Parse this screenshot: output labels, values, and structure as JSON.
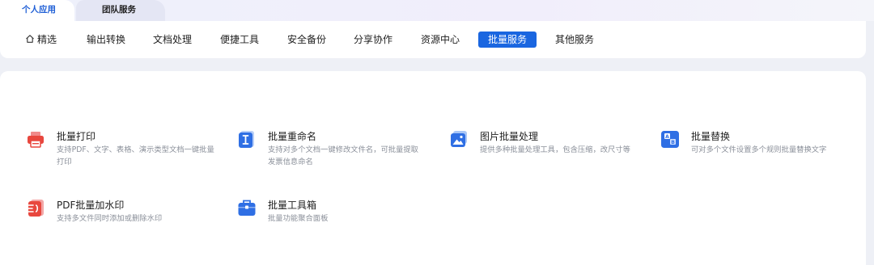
{
  "top_tabs": {
    "personal": "个人应用",
    "team": "团队服务"
  },
  "nav": {
    "items": [
      "精选",
      "输出转换",
      "文档处理",
      "便捷工具",
      "安全备份",
      "分享协作",
      "资源中心",
      "批量服务",
      "其他服务"
    ],
    "active_index": 7
  },
  "cards": [
    {
      "icon": "printer-icon",
      "title": "批量打印",
      "desc": "支持PDF、文字、表格、演示类型文档一键批量打印"
    },
    {
      "icon": "rename-icon",
      "title": "批量重命名",
      "desc": "支持对多个文档一键修改文件名，可批量提取发票信息命名"
    },
    {
      "icon": "image-batch-icon",
      "title": "图片批量处理",
      "desc": "提供多种批量处理工具，包含压缩，改尺寸等"
    },
    {
      "icon": "replace-icon",
      "title": "批量替换",
      "desc": "可对多个文件设置多个规则批量替换文字"
    },
    {
      "icon": "watermark-icon",
      "title": "PDF批量加水印",
      "desc": "支持多文件同时添加或删除水印"
    },
    {
      "icon": "toolbox-icon",
      "title": "批量工具箱",
      "desc": "批量功能聚合面板"
    }
  ],
  "colors": {
    "accent": "#1a66e0",
    "red": "#e8473e",
    "blue": "#2f6fe4"
  }
}
